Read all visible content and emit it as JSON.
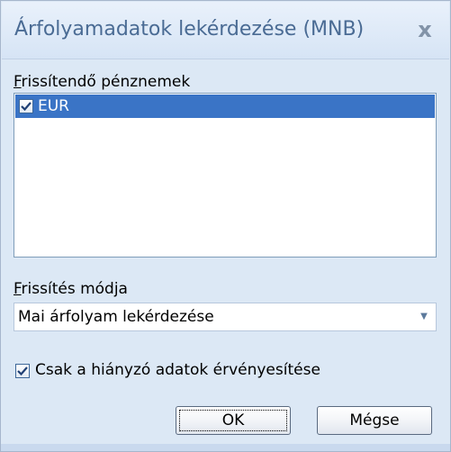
{
  "dialog": {
    "title": "Árfolyamadatok lekérdezése (MNB)",
    "close_glyph": "x",
    "accent_color": "#3a74c6"
  },
  "currencies": {
    "label_hotkey": "F",
    "label_rest": "rissítendő pénznemek",
    "items": [
      {
        "label": "EUR",
        "checked": true,
        "selected": true
      }
    ]
  },
  "update_mode": {
    "label_hotkey": "F",
    "label_rest": "rissítés módja",
    "selected_value": "Mai árfolyam lekérdezése"
  },
  "only_missing": {
    "label": "Csak a hiányzó adatok érvényesítése",
    "checked": true
  },
  "buttons": {
    "ok_label": "OK",
    "cancel_label": "Mégse"
  }
}
